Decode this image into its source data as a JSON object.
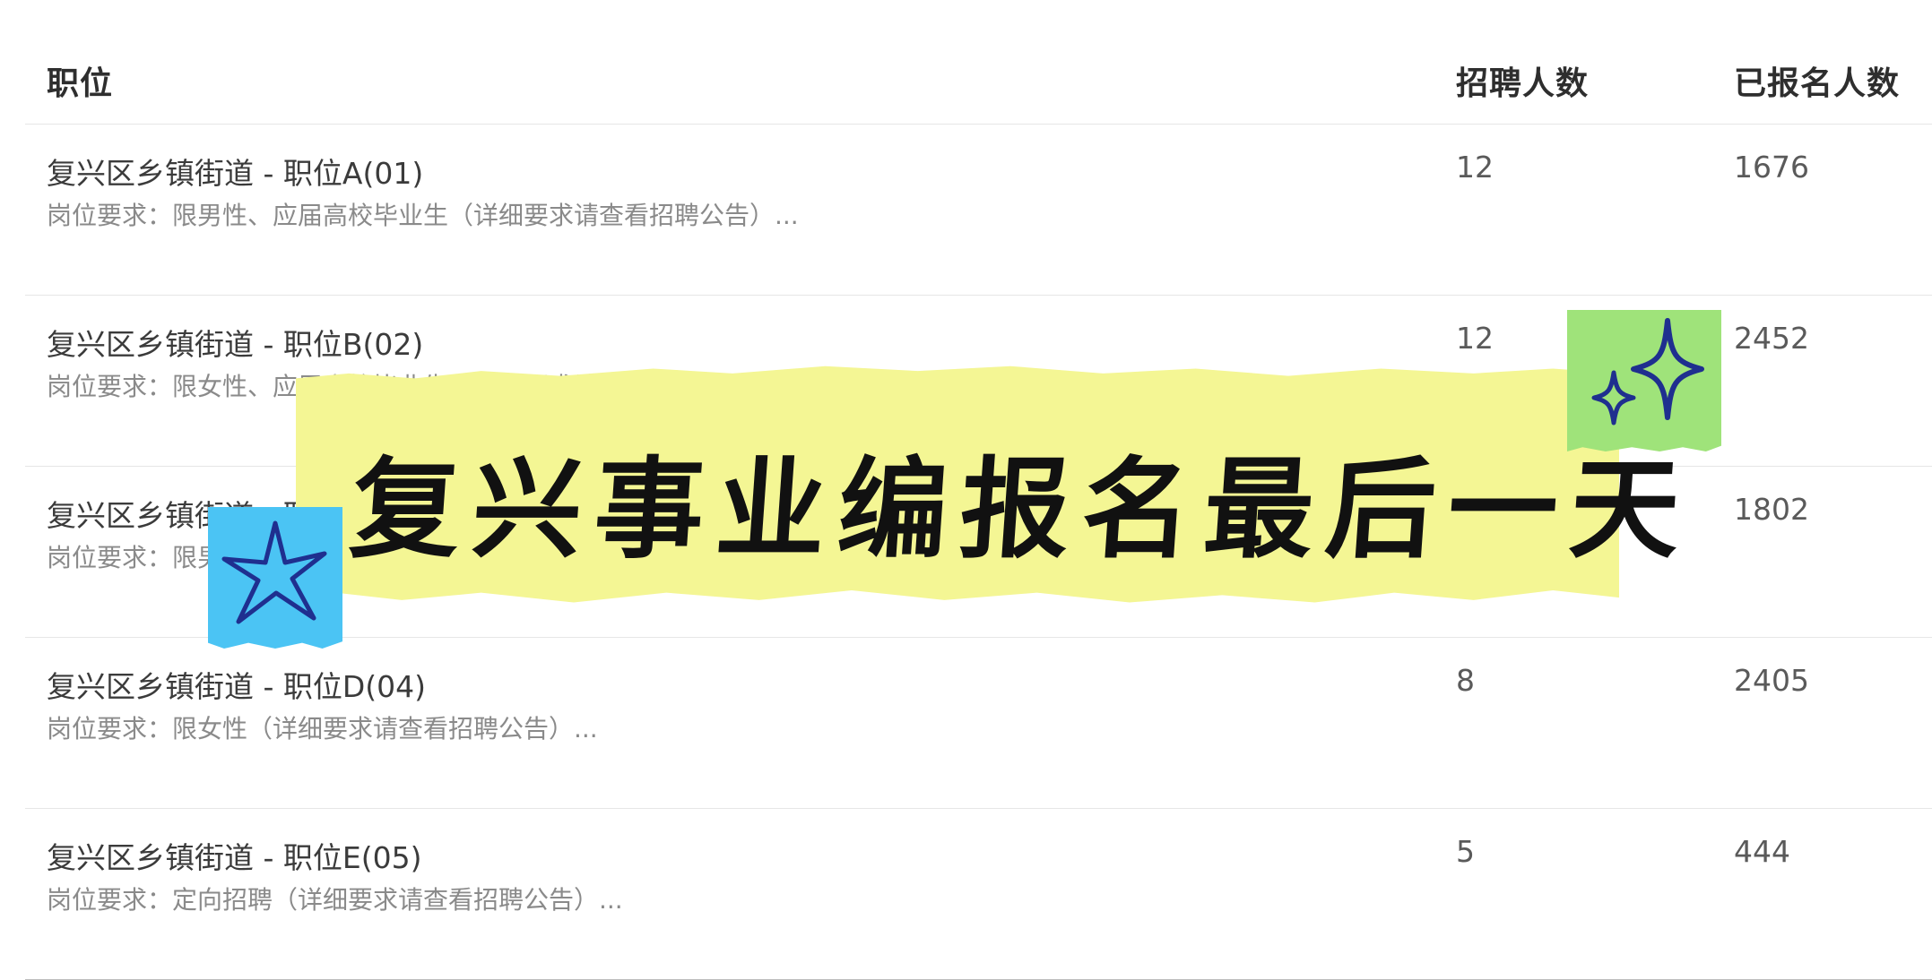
{
  "table": {
    "headers": {
      "position": "职位",
      "hire_count": "招聘人数",
      "applied_count": "已报名人数"
    },
    "rows": [
      {
        "title": "复兴区乡镇街道 - 职位A(01)",
        "requirement": "岗位要求：限男性、应届高校毕业生（详细要求请查看招聘公告）...",
        "hire_count": "12",
        "applied_count": "1676"
      },
      {
        "title": "复兴区乡镇街道 - 职位B(02)",
        "requirement": "岗位要求：限女性、应届高校毕业生（详细要求请查看招聘公告）...",
        "hire_count": "12",
        "applied_count": "2452"
      },
      {
        "title": "复兴区乡镇街道 - 职位C(03)",
        "requirement": "岗位要求：限男性（详细要求请查看招聘公告）...",
        "hire_count": "",
        "applied_count": "1802"
      },
      {
        "title": "复兴区乡镇街道 - 职位D(04)",
        "requirement": "岗位要求：限女性（详细要求请查看招聘公告）...",
        "hire_count": "8",
        "applied_count": "2405"
      },
      {
        "title": "复兴区乡镇街道 - 职位E(05)",
        "requirement": "岗位要求：定向招聘（详细要求请查看招聘公告）...",
        "hire_count": "5",
        "applied_count": "444"
      }
    ]
  },
  "overlay": {
    "banner_text": "复兴事业编报名最后一天",
    "banner_color": "#f4f694",
    "sticker_colors": {
      "green": "#9fe37a",
      "blue": "#4bc4f4"
    },
    "star_color": "#1f2f8f",
    "icons": [
      "sparkle-icon",
      "star-icon"
    ]
  }
}
